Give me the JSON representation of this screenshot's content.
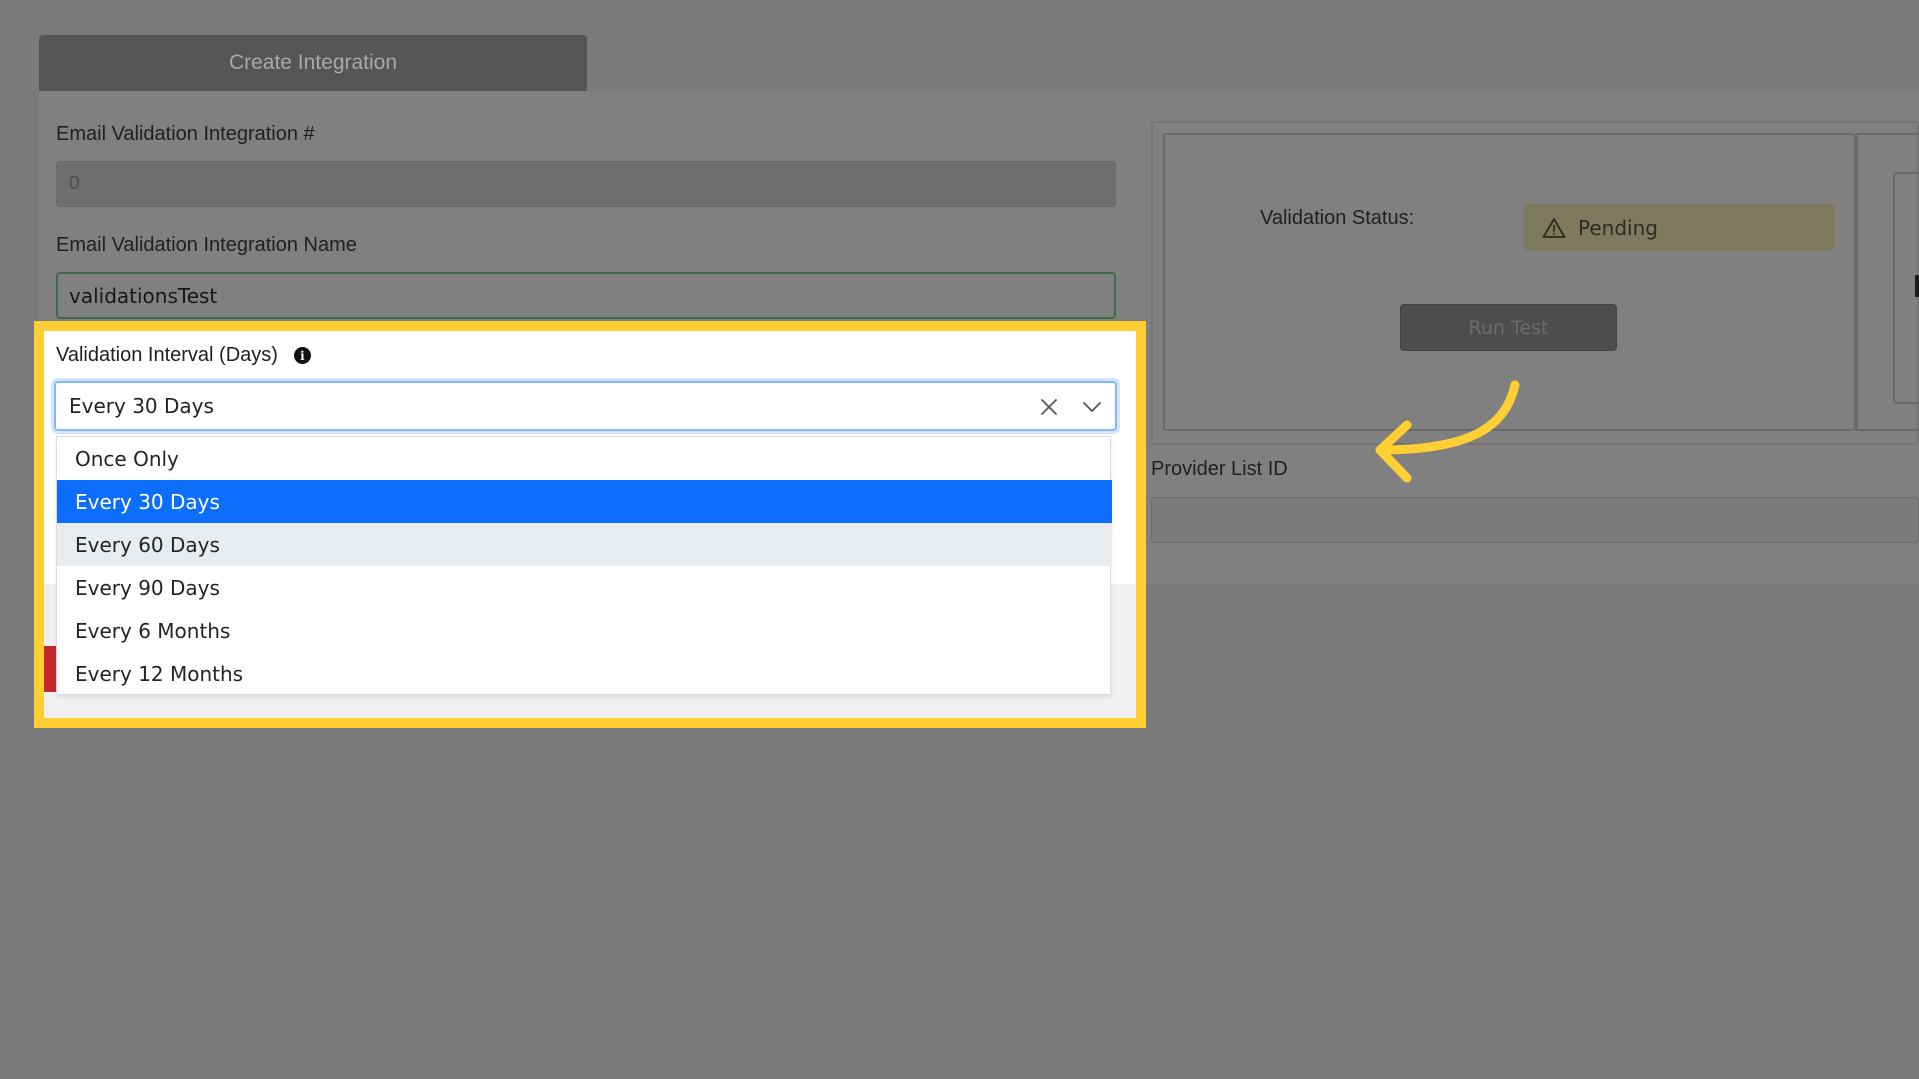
{
  "header": {
    "tab_label": "Create Integration"
  },
  "form": {
    "integration_number_label": "Email Validation Integration #",
    "integration_number_value": "0",
    "integration_name_label": "Email Validation Integration Name",
    "integration_name_value": "validationsTest",
    "interval_label": "Validation Interval (Days)",
    "interval_info_icon": "info-circle-icon",
    "interval_selected": "Every 30 Days",
    "interval_options": [
      "Once Only",
      "Every 30 Days",
      "Every 60 Days",
      "Every 90 Days",
      "Every 6 Months",
      "Every 12 Months"
    ],
    "selected_index": 1,
    "hovered_index": 2
  },
  "status_panel": {
    "status_label": "Validation Status:",
    "status_value": "Pending",
    "status_icon": "warning-triangle-icon",
    "run_test_label": "Run Test"
  },
  "provider": {
    "list_id_label": "Provider List ID",
    "list_id_value": ""
  },
  "colors": {
    "highlight": "#ffcf33",
    "selected_option": "#0d6efd",
    "hovered_option": "#e9ecef",
    "pending_badge": "#7d7a60",
    "error_bar": "#c62828"
  }
}
